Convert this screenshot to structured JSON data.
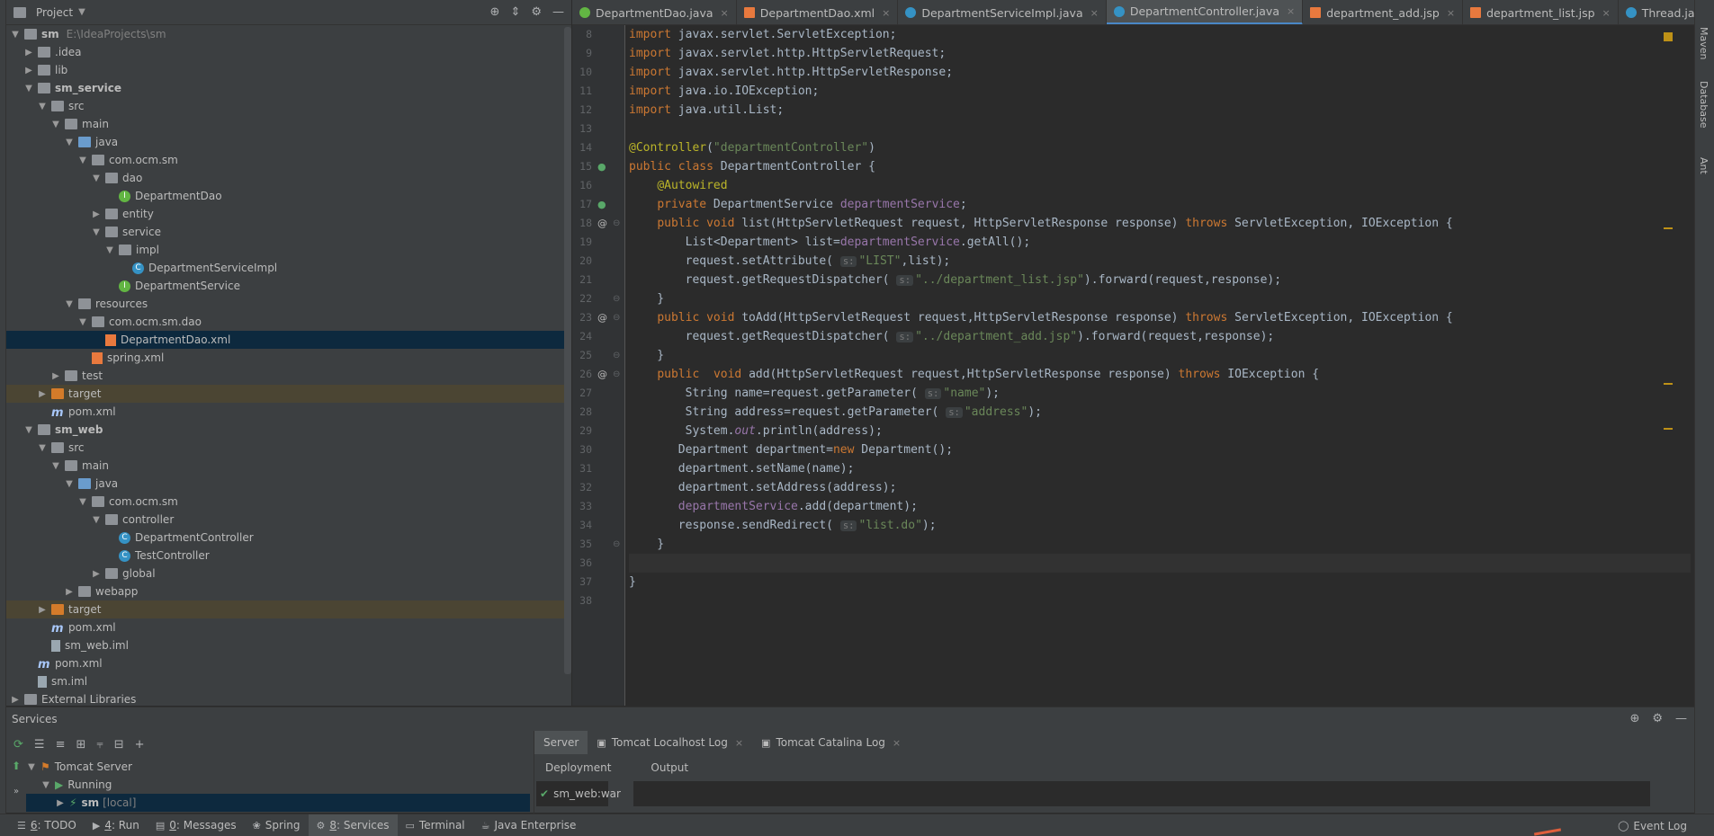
{
  "project": {
    "title": "Project",
    "tree": [
      {
        "label": "sm",
        "path": "E:\\IdeaProjects\\sm",
        "bold": true,
        "icon": "folder",
        "arrow": "▼"
      },
      {
        "label": ".idea",
        "icon": "folder",
        "arrow": "▶"
      },
      {
        "label": "lib",
        "icon": "folder",
        "arrow": "▶"
      },
      {
        "label": "sm_service",
        "bold": true,
        "icon": "folder",
        "arrow": "▼"
      },
      {
        "label": "src",
        "icon": "folder",
        "arrow": "▼"
      },
      {
        "label": "main",
        "icon": "folder",
        "arrow": "▼"
      },
      {
        "label": "java",
        "icon": "folder-blue",
        "arrow": "▼"
      },
      {
        "label": "com.ocm.sm",
        "icon": "folder",
        "arrow": "▼"
      },
      {
        "label": "dao",
        "icon": "folder",
        "arrow": "▼"
      },
      {
        "label": "DepartmentDao",
        "icon": "interface"
      },
      {
        "label": "entity",
        "icon": "folder",
        "arrow": "▶"
      },
      {
        "label": "service",
        "icon": "folder",
        "arrow": "▼"
      },
      {
        "label": "impl",
        "icon": "folder",
        "arrow": "▼"
      },
      {
        "label": "DepartmentServiceImpl",
        "icon": "class"
      },
      {
        "label": "DepartmentService",
        "icon": "interface"
      },
      {
        "label": "resources",
        "icon": "folder",
        "arrow": "▼"
      },
      {
        "label": "com.ocm.sm.dao",
        "icon": "folder",
        "arrow": "▼"
      },
      {
        "label": "DepartmentDao.xml",
        "icon": "xml",
        "selected": true
      },
      {
        "label": "spring.xml",
        "icon": "xml"
      },
      {
        "label": "test",
        "icon": "folder",
        "arrow": "▶"
      },
      {
        "label": "target",
        "icon": "folder-orange",
        "arrow": "▶",
        "excluded": true
      },
      {
        "label": "pom.xml",
        "icon": "pom"
      },
      {
        "label": "sm_web",
        "bold": true,
        "icon": "folder",
        "arrow": "▼"
      },
      {
        "label": "src",
        "icon": "folder",
        "arrow": "▼"
      },
      {
        "label": "main",
        "icon": "folder",
        "arrow": "▼"
      },
      {
        "label": "java",
        "icon": "folder-blue",
        "arrow": "▼"
      },
      {
        "label": "com.ocm.sm",
        "icon": "folder",
        "arrow": "▼"
      },
      {
        "label": "controller",
        "icon": "folder",
        "arrow": "▼"
      },
      {
        "label": "DepartmentController",
        "icon": "class"
      },
      {
        "label": "TestController",
        "icon": "class"
      },
      {
        "label": "global",
        "icon": "folder",
        "arrow": "▶"
      },
      {
        "label": "webapp",
        "icon": "folder",
        "arrow": "▶"
      },
      {
        "label": "target",
        "icon": "folder-orange",
        "arrow": "▶",
        "excluded": true
      },
      {
        "label": "pom.xml",
        "icon": "pom"
      },
      {
        "label": "sm_web.iml",
        "icon": "iml"
      },
      {
        "label": "pom.xml",
        "icon": "pom"
      },
      {
        "label": "sm.iml",
        "icon": "iml"
      },
      {
        "label": "External Libraries",
        "icon": "folder",
        "arrow": "▶"
      }
    ]
  },
  "editor": {
    "tabs": [
      {
        "label": "DepartmentDao.java",
        "icon": "interface",
        "active": false
      },
      {
        "label": "DepartmentDao.xml",
        "icon": "xml",
        "active": false
      },
      {
        "label": "DepartmentServiceImpl.java",
        "icon": "class",
        "active": false
      },
      {
        "label": "DepartmentController.java",
        "icon": "class",
        "active": true
      },
      {
        "label": "department_add.jsp",
        "icon": "jsp",
        "active": false
      },
      {
        "label": "department_list.jsp",
        "icon": "jsp",
        "active": false
      },
      {
        "label": "Thread.java",
        "icon": "class",
        "active": false
      }
    ],
    "line_numbers": [
      "8",
      "9",
      "10",
      "11",
      "12",
      "13",
      "14",
      "15",
      "16",
      "17",
      "18",
      "19",
      "20",
      "21",
      "22",
      "23",
      "24",
      "25",
      "26",
      "27",
      "28",
      "29",
      "30",
      "31",
      "32",
      "33",
      "34",
      "35",
      "36",
      "37",
      "38"
    ],
    "current_line": "36"
  },
  "right_tools": {
    "maven": "Maven",
    "database": "Database",
    "ant": "Ant"
  },
  "services": {
    "title": "Services",
    "tree": [
      {
        "label": "Tomcat Server",
        "icon": "tomcat-icon",
        "arrow": "▼",
        "indent": 1
      },
      {
        "label": "Running",
        "icon": "run-icon",
        "arrow": "▼",
        "indent": 2
      },
      {
        "label": "sm",
        "suffix": "[local]",
        "icon": "deploy-icon",
        "arrow": "▶",
        "indent": 3,
        "selected": true
      }
    ],
    "tabs": [
      {
        "label": "Server",
        "active": true
      },
      {
        "label": "Tomcat Localhost Log",
        "active": false
      },
      {
        "label": "Tomcat Catalina Log",
        "active": false
      }
    ],
    "sub_tabs": {
      "deployment": "Deployment",
      "output": "Output"
    },
    "deployment_item": "sm_web:war"
  },
  "statusbar": {
    "items": [
      {
        "key": "6",
        "label": ": TODO",
        "active": false
      },
      {
        "key": "4",
        "label": ": Run",
        "active": false
      },
      {
        "key": "0",
        "label": ": Messages",
        "active": false
      },
      {
        "key": "",
        "label": "Spring",
        "active": false
      },
      {
        "key": "8",
        "label": ": Services",
        "active": true
      },
      {
        "key": "",
        "label": "Terminal",
        "active": false
      },
      {
        "key": "",
        "label": "Java Enterprise",
        "active": false
      }
    ],
    "event_log": "Event Log"
  }
}
